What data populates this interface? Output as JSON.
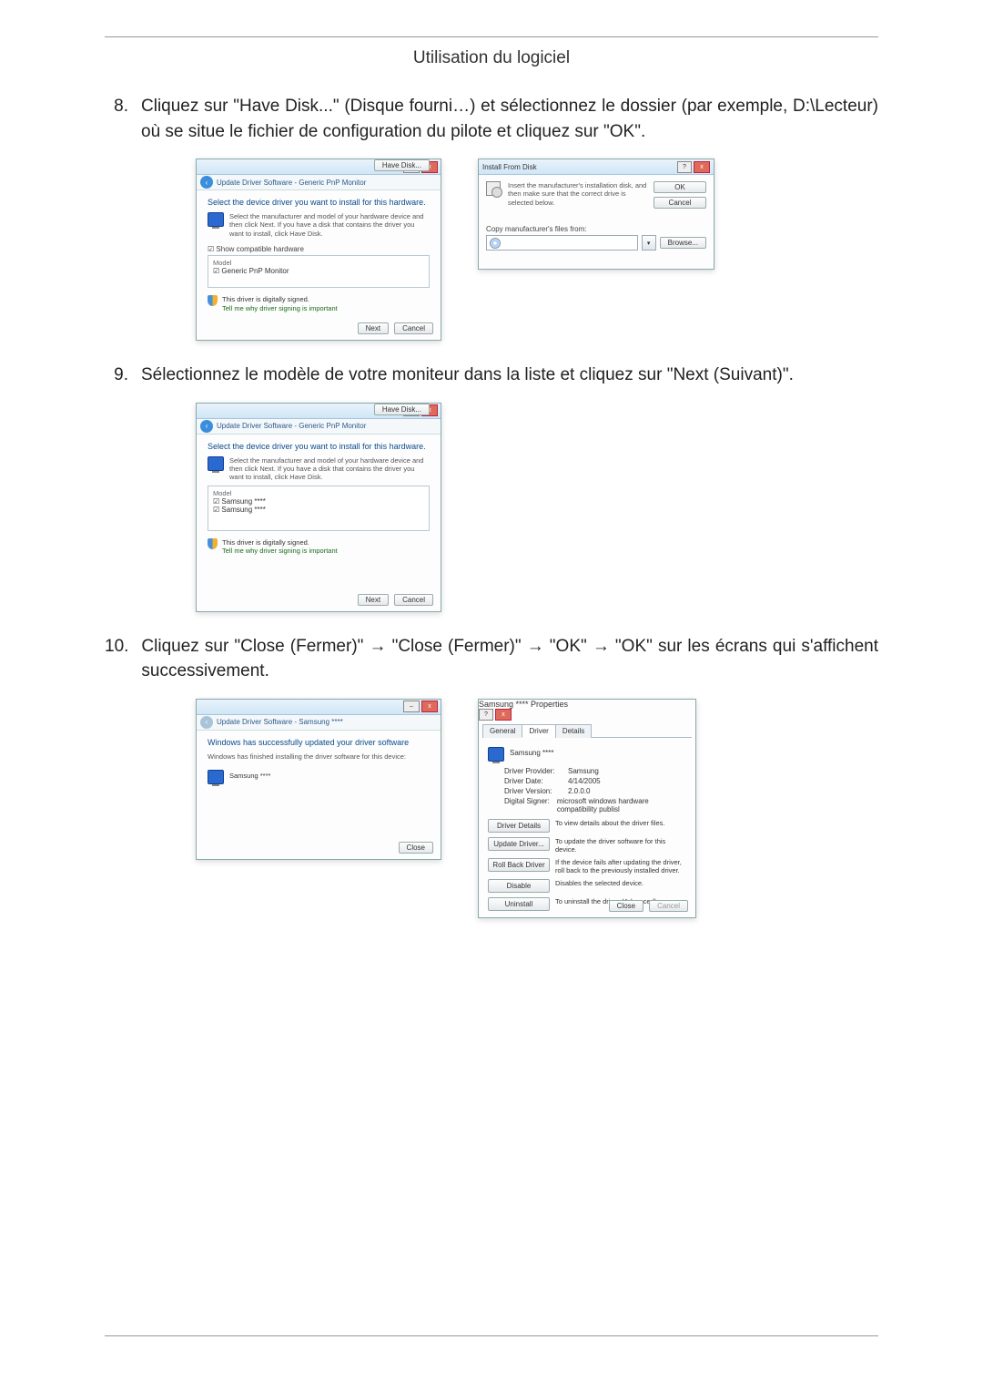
{
  "header": {
    "title": "Utilisation du logiciel"
  },
  "steps": {
    "s8": {
      "num": "8.",
      "text": "Cliquez sur \"Have Disk...\" (Disque fourni…) et sélectionnez le dossier (par exemple, D:\\Lecteur) où se situe le fichier de configuration du pilote et cliquez sur \"OK\"."
    },
    "s9": {
      "num": "9.",
      "text": "Sélectionnez le modèle de votre moniteur dans la liste et cliquez sur \"Next (Suivant)\"."
    },
    "s10": {
      "num": "10.",
      "text": "Cliquez sur \"Close (Fermer)\" → \"Close (Fermer)\" → \"OK\" → \"OK\" sur les écrans qui s'affichent successivement."
    }
  },
  "winA": {
    "crumb": "Update Driver Software - Generic PnP Monitor",
    "heading": "Select the device driver you want to install for this hardware.",
    "desc": "Select the manufacturer and model of your hardware device and then click Next. If you have a disk that contains the driver you want to install, click Have Disk.",
    "checkbox": "Show compatible hardware",
    "listHeader": "Model",
    "item1": "Generic PnP Monitor",
    "signed": "This driver is digitally signed.",
    "signedLink": "Tell me why driver signing is important",
    "haveDisk": "Have Disk...",
    "next": "Next",
    "cancel": "Cancel"
  },
  "winB": {
    "title": "Install From Disk",
    "msg": "Insert the manufacturer's installation disk, and then make sure that the correct drive is selected below.",
    "ok": "OK",
    "cancel": "Cancel",
    "copyLabel": "Copy manufacturer's files from:",
    "browse": "Browse..."
  },
  "winC": {
    "crumb": "Update Driver Software - Generic PnP Monitor",
    "heading": "Select the device driver you want to install for this hardware.",
    "desc": "Select the manufacturer and model of your hardware device and then click Next. If you have a disk that contains the driver you want to install, click Have Disk.",
    "listHeader": "Model",
    "item1": "Samsung ****",
    "item2": "Samsung ****",
    "signed": "This driver is digitally signed.",
    "signedLink": "Tell me why driver signing is important",
    "haveDisk": "Have Disk...",
    "next": "Next",
    "cancel": "Cancel"
  },
  "winD": {
    "crumb": "Update Driver Software - Samsung ****",
    "heading": "Windows has successfully updated your driver software",
    "desc": "Windows has finished installing the driver software for this device:",
    "item": "Samsung ****",
    "close": "Close"
  },
  "winE": {
    "title": "Samsung **** Properties",
    "tabs": {
      "general": "General",
      "driver": "Driver",
      "details": "Details"
    },
    "device": "Samsung ****",
    "kv": {
      "provider_k": "Driver Provider:",
      "provider_v": "Samsung",
      "date_k": "Driver Date:",
      "date_v": "4/14/2005",
      "version_k": "Driver Version:",
      "version_v": "2.0.0.0",
      "signer_k": "Digital Signer:",
      "signer_v": "microsoft windows hardware compatibility publisl"
    },
    "actions": {
      "details_b": "Driver Details",
      "details_d": "To view details about the driver files.",
      "update_b": "Update Driver...",
      "update_d": "To update the driver software for this device.",
      "rollback_b": "Roll Back Driver",
      "rollback_d": "If the device fails after updating the driver, roll back to the previously installed driver.",
      "disable_b": "Disable",
      "disable_d": "Disables the selected device.",
      "uninstall_b": "Uninstall",
      "uninstall_d": "To uninstall the driver (Advanced)."
    },
    "close": "Close",
    "cancel": "Cancel"
  }
}
